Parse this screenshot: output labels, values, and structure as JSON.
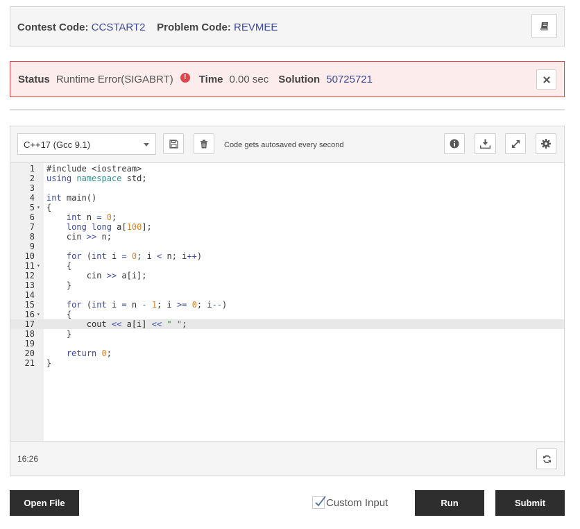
{
  "info": {
    "contest_label": "Contest Code:",
    "contest_value": "CCSTART2",
    "problem_label": "Problem Code:",
    "problem_value": "REVMEE",
    "book_icon": "book-icon"
  },
  "status": {
    "status_label": "Status",
    "status_value": "Runtime Error(SIGABRT)",
    "error_icon": "exclamation-circle-icon",
    "time_label": "Time",
    "time_value": "0.00 sec",
    "solution_label": "Solution",
    "solution_value": "50725721",
    "close_icon": "close-icon",
    "colors": {
      "border": "#e0474c",
      "background": "#fcecec"
    }
  },
  "toolbar": {
    "language": "C++17 (Gcc 9.1)",
    "autosave_text": "Code gets autosaved every second",
    "icons": [
      "save-icon",
      "trash-icon",
      "info-icon",
      "download-icon",
      "fullscreen-icon",
      "settings-icon"
    ]
  },
  "editor": {
    "lines": [
      {
        "n": "1",
        "fold": "",
        "code": "#include <iostream>"
      },
      {
        "n": "2",
        "fold": "",
        "code": "using namespace std;"
      },
      {
        "n": "3",
        "fold": "",
        "code": ""
      },
      {
        "n": "4",
        "fold": "",
        "code": "int main()"
      },
      {
        "n": "5",
        "fold": "▾",
        "code": "{"
      },
      {
        "n": "6",
        "fold": "",
        "code": "    int n = 0;"
      },
      {
        "n": "7",
        "fold": "",
        "code": "    long long a[100];"
      },
      {
        "n": "8",
        "fold": "",
        "code": "    cin >> n;"
      },
      {
        "n": "9",
        "fold": "",
        "code": ""
      },
      {
        "n": "10",
        "fold": "",
        "code": "    for (int i = 0; i < n; i++)"
      },
      {
        "n": "11",
        "fold": "▾",
        "code": "    {"
      },
      {
        "n": "12",
        "fold": "",
        "code": "        cin >> a[i];"
      },
      {
        "n": "13",
        "fold": "",
        "code": "    }"
      },
      {
        "n": "14",
        "fold": "",
        "code": ""
      },
      {
        "n": "15",
        "fold": "",
        "code": "    for (int i = n - 1; i >= 0; i--)"
      },
      {
        "n": "16",
        "fold": "▾",
        "code": "    {"
      },
      {
        "n": "17",
        "fold": "",
        "code": "        cout << a[i] << \" \";"
      },
      {
        "n": "18",
        "fold": "",
        "code": "    }"
      },
      {
        "n": "19",
        "fold": "",
        "code": ""
      },
      {
        "n": "20",
        "fold": "",
        "code": "    return 0;"
      },
      {
        "n": "21",
        "fold": "",
        "code": "}"
      }
    ],
    "active_line": "17",
    "cursor_position": "16:26",
    "refresh_icon": "refresh-icon"
  },
  "actions": {
    "open_file": "Open File",
    "custom_input": "Custom Input",
    "custom_input_checked": true,
    "run": "Run",
    "submit": "Submit"
  }
}
